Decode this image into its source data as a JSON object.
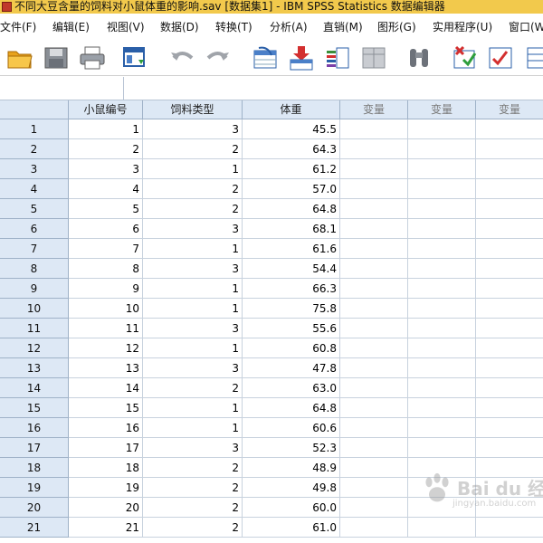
{
  "window": {
    "title": "不同大豆含量的饲料对小鼠体重的影响.sav [数据集1] - IBM SPSS Statistics 数据编辑器"
  },
  "menu": [
    "文件(F)",
    "编辑(E)",
    "视图(V)",
    "数据(D)",
    "转换(T)",
    "分析(A)",
    "直销(M)",
    "图形(G)",
    "实用程序(U)",
    "窗口(W)"
  ],
  "toolbar": {
    "icons": [
      "open-folder-icon",
      "save-icon",
      "print-icon",
      "dialog-recall-icon",
      "undo-icon",
      "redo-icon",
      "goto-case-icon",
      "insert-cases-icon",
      "insert-variable-icon",
      "split-file-icon",
      "find-icon",
      "value-labels-icon",
      "use-sets-icon",
      "more-icon"
    ]
  },
  "columns": [
    "小鼠编号",
    "饲料类型",
    "体重",
    "变量",
    "变量",
    "变量"
  ],
  "rows": [
    {
      "n": "1",
      "id": "1",
      "type": "3",
      "weight": "45.5"
    },
    {
      "n": "2",
      "id": "2",
      "type": "2",
      "weight": "64.3"
    },
    {
      "n": "3",
      "id": "3",
      "type": "1",
      "weight": "61.2"
    },
    {
      "n": "4",
      "id": "4",
      "type": "2",
      "weight": "57.0"
    },
    {
      "n": "5",
      "id": "5",
      "type": "2",
      "weight": "64.8"
    },
    {
      "n": "6",
      "id": "6",
      "type": "3",
      "weight": "68.1"
    },
    {
      "n": "7",
      "id": "7",
      "type": "1",
      "weight": "61.6"
    },
    {
      "n": "8",
      "id": "8",
      "type": "3",
      "weight": "54.4"
    },
    {
      "n": "9",
      "id": "9",
      "type": "1",
      "weight": "66.3"
    },
    {
      "n": "10",
      "id": "10",
      "type": "1",
      "weight": "75.8"
    },
    {
      "n": "11",
      "id": "11",
      "type": "3",
      "weight": "55.6"
    },
    {
      "n": "12",
      "id": "12",
      "type": "1",
      "weight": "60.8"
    },
    {
      "n": "13",
      "id": "13",
      "type": "3",
      "weight": "47.8"
    },
    {
      "n": "14",
      "id": "14",
      "type": "2",
      "weight": "63.0"
    },
    {
      "n": "15",
      "id": "15",
      "type": "1",
      "weight": "64.8"
    },
    {
      "n": "16",
      "id": "16",
      "type": "1",
      "weight": "60.6"
    },
    {
      "n": "17",
      "id": "17",
      "type": "3",
      "weight": "52.3"
    },
    {
      "n": "18",
      "id": "18",
      "type": "2",
      "weight": "48.9"
    },
    {
      "n": "19",
      "id": "19",
      "type": "2",
      "weight": "49.8"
    },
    {
      "n": "20",
      "id": "20",
      "type": "2",
      "weight": "60.0"
    },
    {
      "n": "21",
      "id": "21",
      "type": "2",
      "weight": "61.0"
    }
  ],
  "watermark": {
    "brand": "Bai du 经验",
    "url": "jingyan.baidu.com"
  },
  "colors": {
    "titlebar": "#f2c94c",
    "header_bg": "#dde8f5",
    "grid_line": "#c8d2de"
  }
}
